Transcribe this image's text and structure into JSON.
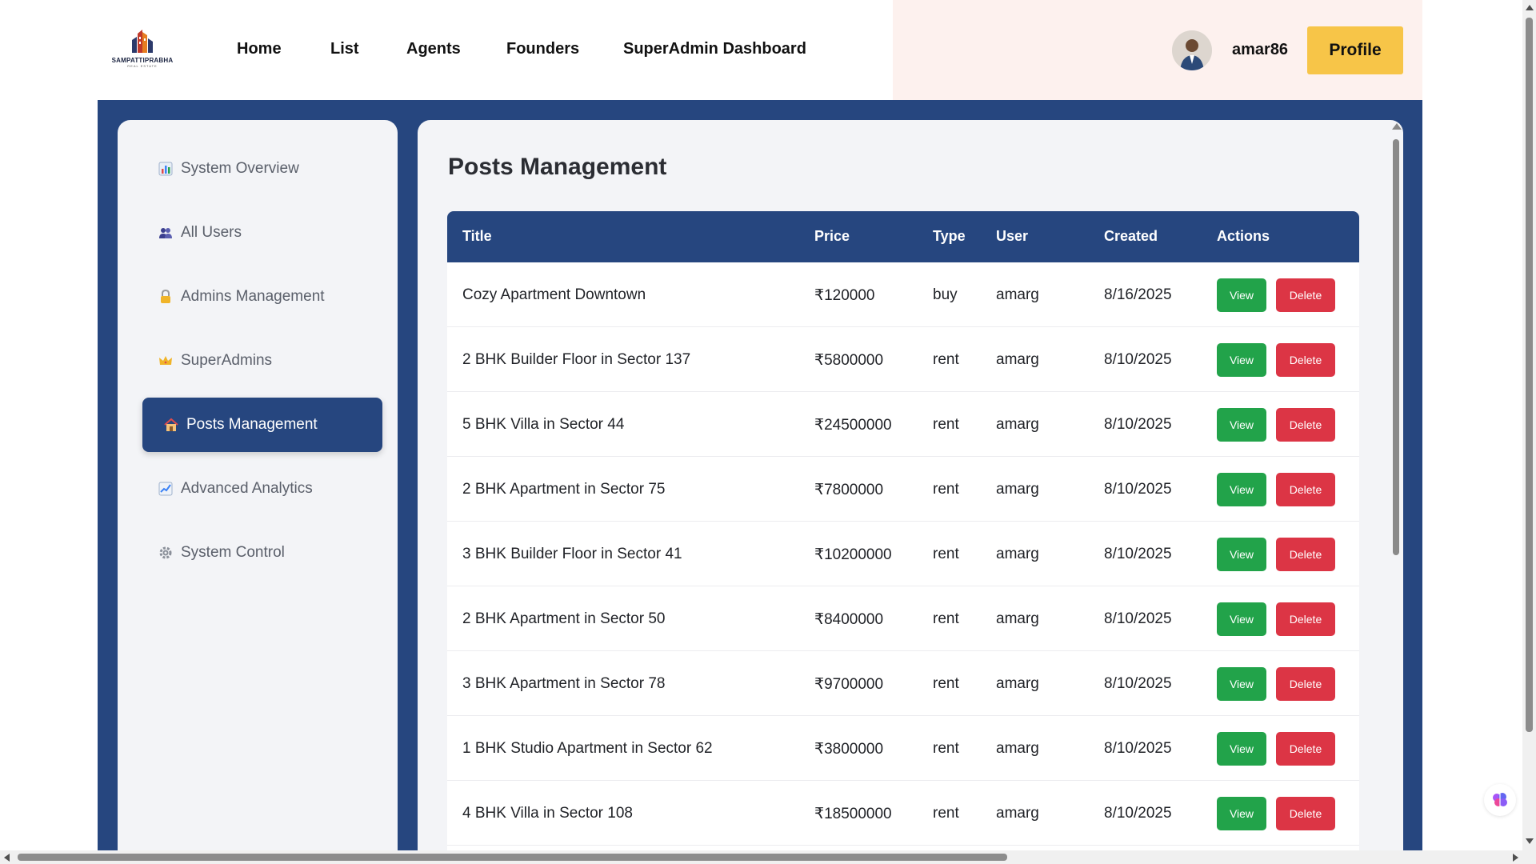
{
  "brand": {
    "name": "SAMPATTIPRABHA",
    "tagline": "REAL ESTATE"
  },
  "nav": {
    "links": [
      "Home",
      "List",
      "Agents",
      "Founders",
      "SuperAdmin Dashboard"
    ],
    "username": "amar86",
    "profile_label": "Profile"
  },
  "sidebar": {
    "items": [
      {
        "label": "System Overview",
        "icon": "bar-chart-icon"
      },
      {
        "label": "All Users",
        "icon": "users-icon"
      },
      {
        "label": "Admins Management",
        "icon": "lock-icon"
      },
      {
        "label": "SuperAdmins",
        "icon": "crown-icon"
      },
      {
        "label": "Posts Management",
        "icon": "house-icon",
        "active": true
      },
      {
        "label": "Advanced Analytics",
        "icon": "trend-chart-icon"
      },
      {
        "label": "System Control",
        "icon": "gear-icon"
      }
    ]
  },
  "main": {
    "title": "Posts Management",
    "columns": [
      "Title",
      "Price",
      "Type",
      "User",
      "Created",
      "Actions"
    ],
    "view_label": "View",
    "delete_label": "Delete",
    "rows": [
      {
        "title": "Cozy Apartment Downtown",
        "price": "₹120000",
        "type": "buy",
        "user": "amarg",
        "created": "8/16/2025"
      },
      {
        "title": "2 BHK Builder Floor in Sector 137",
        "price": "₹5800000",
        "type": "rent",
        "user": "amarg",
        "created": "8/10/2025"
      },
      {
        "title": "5 BHK Villa in Sector 44",
        "price": "₹24500000",
        "type": "rent",
        "user": "amarg",
        "created": "8/10/2025"
      },
      {
        "title": "2 BHK Apartment in Sector 75",
        "price": "₹7800000",
        "type": "rent",
        "user": "amarg",
        "created": "8/10/2025"
      },
      {
        "title": "3 BHK Builder Floor in Sector 41",
        "price": "₹10200000",
        "type": "rent",
        "user": "amarg",
        "created": "8/10/2025"
      },
      {
        "title": "2 BHK Apartment in Sector 50",
        "price": "₹8400000",
        "type": "rent",
        "user": "amarg",
        "created": "8/10/2025"
      },
      {
        "title": "3 BHK Apartment in Sector 78",
        "price": "₹9700000",
        "type": "rent",
        "user": "amarg",
        "created": "8/10/2025"
      },
      {
        "title": "1 BHK Studio Apartment in Sector 62",
        "price": "₹3800000",
        "type": "rent",
        "user": "amarg",
        "created": "8/10/2025"
      },
      {
        "title": "4 BHK Villa in Sector 108",
        "price": "₹18500000",
        "type": "rent",
        "user": "amarg",
        "created": "8/10/2025"
      }
    ]
  },
  "colors": {
    "primary": "#26467f",
    "accent": "#f7c548",
    "view": "#22a34a",
    "delete": "#dc3545"
  }
}
